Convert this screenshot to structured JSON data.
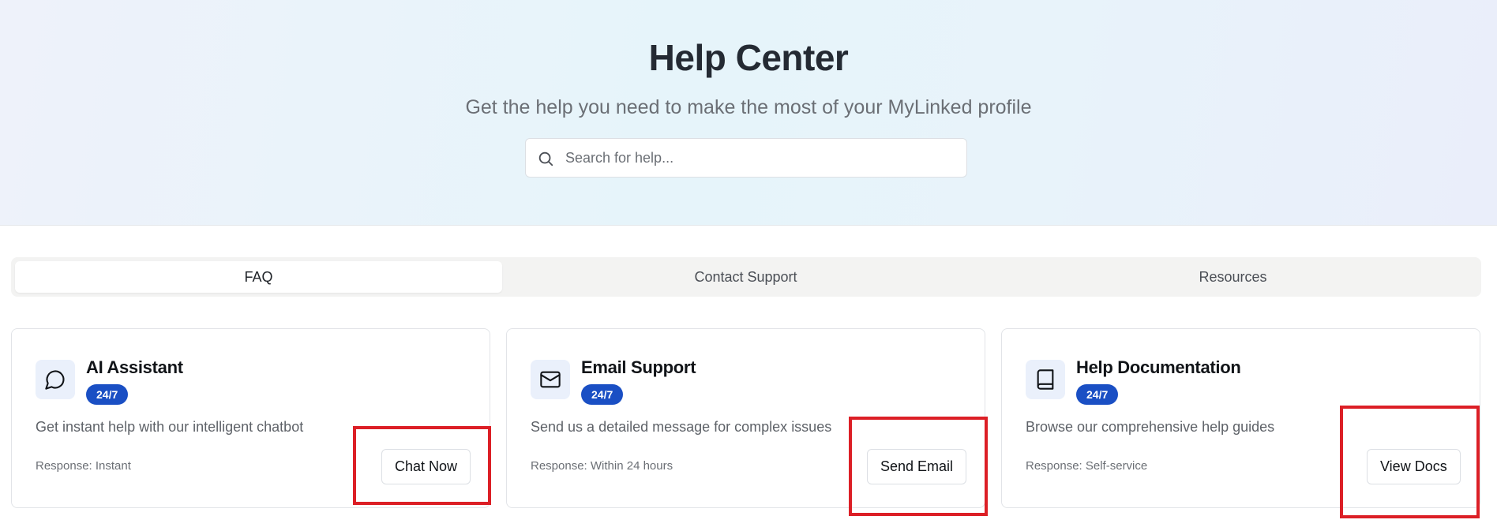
{
  "header": {
    "title": "Help Center",
    "subtitle": "Get the help you need to make the most of your MyLinked profile"
  },
  "search": {
    "placeholder": "Search for help...",
    "value": "",
    "icon": "search-icon"
  },
  "tabs": [
    {
      "label": "FAQ",
      "active": true
    },
    {
      "label": "Contact Support",
      "active": false
    },
    {
      "label": "Resources",
      "active": false
    }
  ],
  "cards": [
    {
      "icon": "chat-bubble-icon",
      "title": "AI Assistant",
      "badge": "24/7",
      "description": "Get instant help with our intelligent chatbot",
      "response": "Response: Instant",
      "button": "Chat Now"
    },
    {
      "icon": "mail-icon",
      "title": "Email Support",
      "badge": "24/7",
      "description": "Send us a detailed message for complex issues",
      "response": "Response: Within 24 hours",
      "button": "Send Email"
    },
    {
      "icon": "book-icon",
      "title": "Help Documentation",
      "badge": "24/7",
      "description": "Browse our comprehensive help guides",
      "response": "Response: Self-service",
      "button": "View Docs"
    }
  ],
  "colors": {
    "accent": "#1a4fc4",
    "highlight": "#dc1f26",
    "icon_tile": "#eaf0fb"
  }
}
